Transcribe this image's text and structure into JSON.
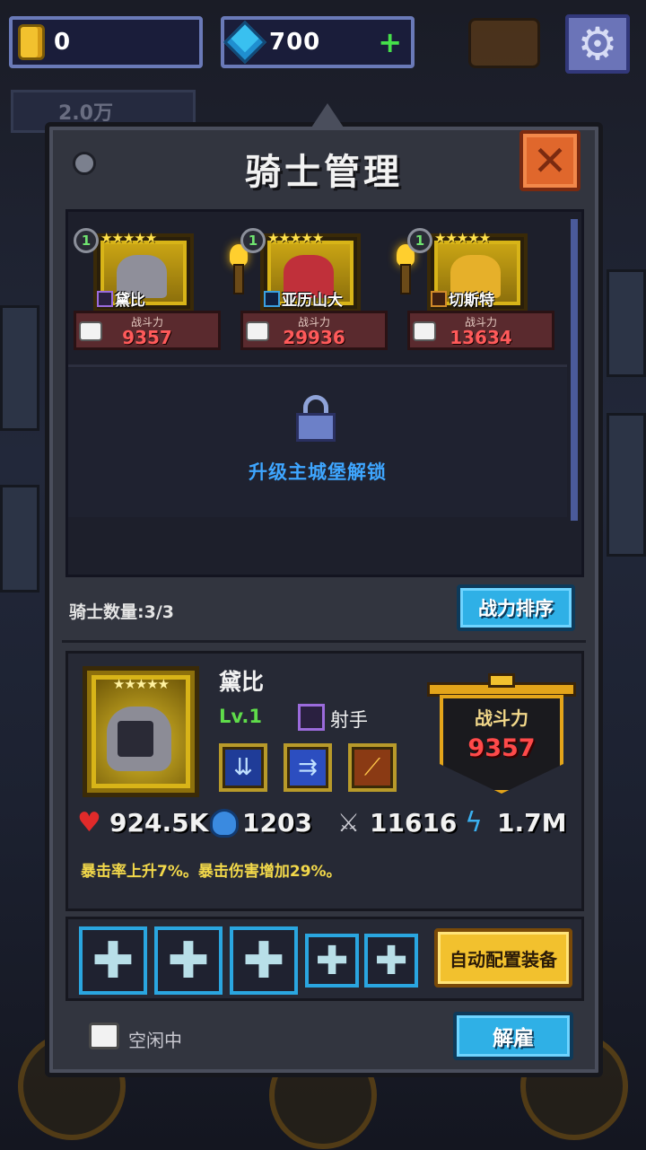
{
  "resources": {
    "gold": "0",
    "gems": "700",
    "gems_add": "+"
  },
  "background": {
    "badge_value": "2.0万"
  },
  "panel": {
    "title": "骑士管理",
    "close_label": "✕"
  },
  "roster": {
    "knights": [
      {
        "level": "1",
        "stars": "★★★★★",
        "name": "黛比",
        "power_label": "战斗力",
        "power": "9357",
        "avatar_color": "#8f8f9a"
      },
      {
        "level": "1",
        "stars": "★★★★★",
        "name": "亚历山大",
        "power_label": "战斗力",
        "power": "29936",
        "avatar_color": "#c0303a"
      },
      {
        "level": "1",
        "stars": "★★★★★",
        "name": "切斯特",
        "power_label": "战斗力",
        "power": "13634",
        "avatar_color": "#e6b02a"
      }
    ],
    "locked_text": "升级主城堡解锁"
  },
  "knight_count": "骑士数量:3/3",
  "sort_button": "战力排序",
  "detail": {
    "stars": "★★★★★",
    "name": "黛比",
    "level": "Lv.1",
    "class": "射手",
    "power_label": "战斗力",
    "power": "9357",
    "stats": {
      "hp": "924.5K",
      "mana": "1203",
      "attack": "11616",
      "speed": "1.7M"
    },
    "crit_text": "暴击率上升7%。暴击伤害增加29%。"
  },
  "equipment": {
    "slot_symbol": "✚",
    "auto_button": "自动配置装备"
  },
  "status": {
    "idle_text": "空闲中"
  },
  "fire_button": "解雇"
}
